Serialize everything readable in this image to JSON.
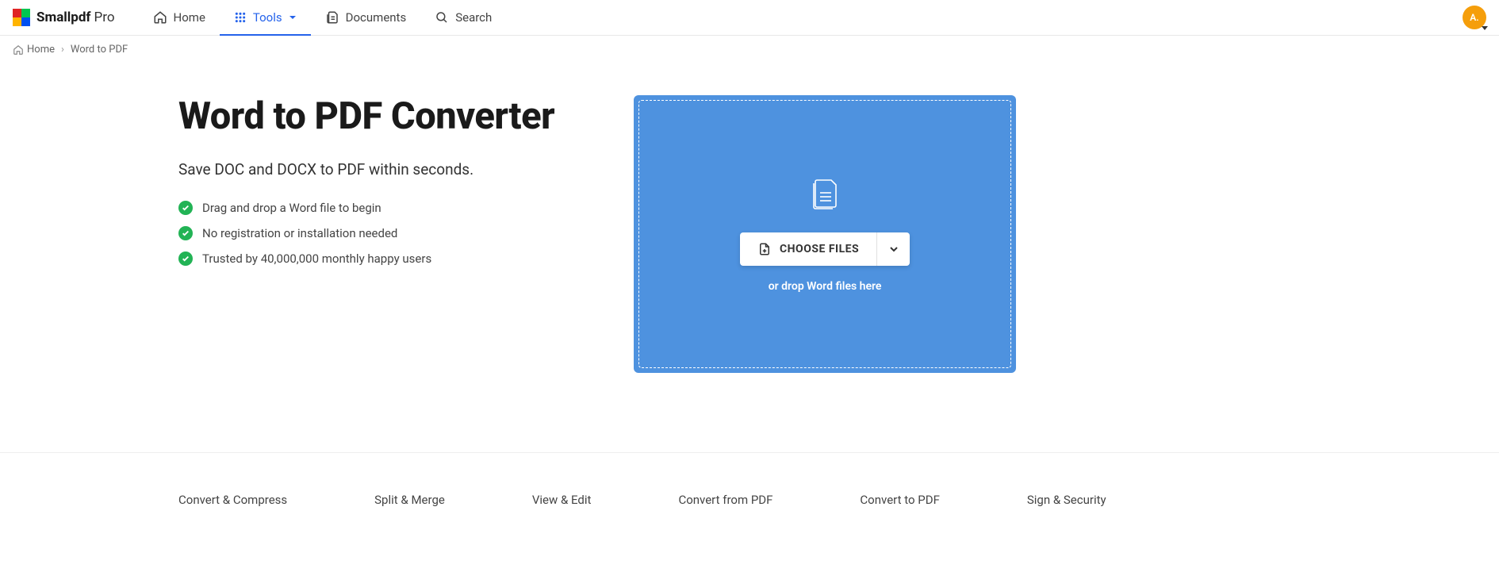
{
  "brand": {
    "name": "Smallpdf",
    "suffix": "Pro"
  },
  "nav": {
    "home": "Home",
    "tools": "Tools",
    "documents": "Documents",
    "search": "Search"
  },
  "avatar": {
    "initial": "A."
  },
  "breadcrumb": {
    "home": "Home",
    "current": "Word to PDF"
  },
  "page": {
    "title": "Word to PDF Converter",
    "subtitle": "Save DOC and DOCX to PDF within seconds.",
    "features": [
      "Drag and drop a Word file to begin",
      "No registration or installation needed",
      "Trusted by 40,000,000 monthly happy users"
    ]
  },
  "dropzone": {
    "choose_label": "CHOOSE FILES",
    "drop_text": "or drop Word files here"
  },
  "categories": [
    "Convert & Compress",
    "Split & Merge",
    "View & Edit",
    "Convert from PDF",
    "Convert to PDF",
    "Sign & Security"
  ]
}
